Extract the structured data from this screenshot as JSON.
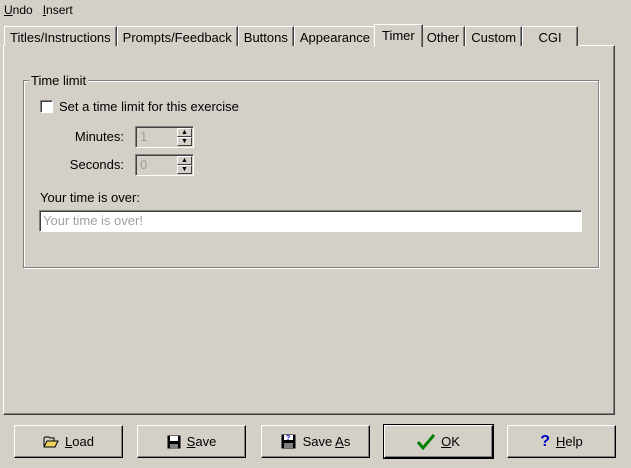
{
  "menu": [
    {
      "label_first": "U",
      "label_rest": "ndo"
    },
    {
      "label_first": "I",
      "label_rest": "nsert"
    }
  ],
  "tabs": [
    "Titles/Instructions",
    "Prompts/Feedback",
    "Buttons",
    "Appearance",
    "Timer",
    "Other",
    "Custom",
    "CGI"
  ],
  "active_tab": "Timer",
  "timer": {
    "group_title": "Time limit",
    "checkbox_label": "Set a time limit for this exercise",
    "checkbox_checked": false,
    "minutes_label": "Minutes:",
    "minutes_value": "1",
    "seconds_label": "Seconds:",
    "seconds_value": "0",
    "message_label": "Your time is over:",
    "message_value": "Your time is over!"
  },
  "buttons": {
    "load": {
      "first": "L",
      "rest": "oad",
      "icon": "folder-open-icon"
    },
    "save": {
      "first": "S",
      "rest": "ave",
      "icon": "floppy-disk-icon"
    },
    "save_as": {
      "pre": "Save ",
      "first": "A",
      "rest": "s",
      "icon": "floppy-disk-question-icon"
    },
    "ok": {
      "first": "O",
      "rest": "K",
      "icon": "green-check-icon"
    },
    "help": {
      "first": "H",
      "rest": "elp",
      "icon": "blue-question-icon"
    }
  },
  "colors": {
    "face": "#d4d0c8",
    "ok_check": "#008000",
    "help_question": "#0000c0"
  }
}
